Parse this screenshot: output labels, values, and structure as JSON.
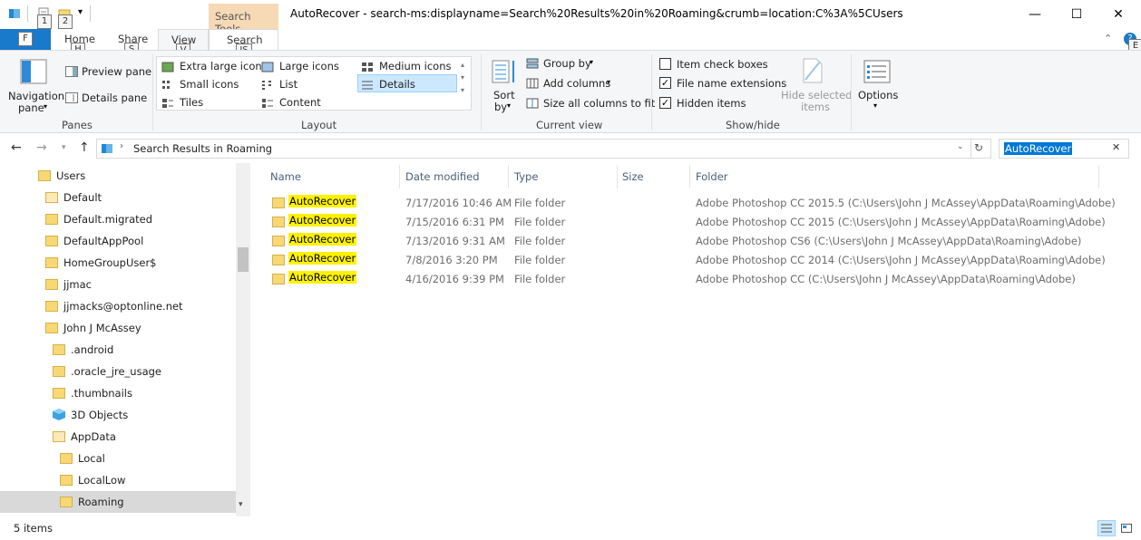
{
  "window": {
    "title": "AutoRecover - search-ms:displayname=Search%20Results%20in%20Roaming&crumb=location:C%3A%5CUsers",
    "context_tab": "Search Tools",
    "minimize": "—",
    "maximize": "☐",
    "close": "✕"
  },
  "qat": {
    "keytip_1": "1",
    "keytip_2": "2"
  },
  "tabs": {
    "file": "F",
    "home": "Home",
    "home_keytip": "H",
    "share": "Share",
    "share_keytip": "S",
    "view": "View",
    "view_keytip": "V",
    "search": "Search",
    "search_keytip": "JS",
    "help_keytip": "E"
  },
  "ribbon": {
    "panes": {
      "navigation_pane": "Navigation",
      "navigation_pane_2": "pane",
      "preview_pane": "Preview pane",
      "details_pane": "Details pane",
      "label": "Panes"
    },
    "layout": {
      "extra_large": "Extra large icons",
      "large": "Large icons",
      "medium": "Medium icons",
      "small": "Small icons",
      "list": "List",
      "details": "Details",
      "tiles": "Tiles",
      "content": "Content",
      "label": "Layout"
    },
    "current_view": {
      "sort_by": "Sort",
      "sort_by_2": "by",
      "group_by": "Group by",
      "add_columns": "Add columns",
      "size_all": "Size all columns to fit",
      "label": "Current view"
    },
    "show_hide": {
      "item_check_boxes": "Item check boxes",
      "item_check_boxes_checked": false,
      "file_name_extensions": "File name extensions",
      "file_name_extensions_checked": true,
      "hidden_items": "Hidden items",
      "hidden_items_checked": true,
      "hide_selected": "Hide selected",
      "hide_selected_2": "items",
      "label": "Show/hide"
    },
    "options": {
      "label": "Options"
    }
  },
  "address": {
    "breadcrumb": "Search Results in Roaming",
    "search_value": "AutoRecover"
  },
  "nav_tree": [
    {
      "label": "Users",
      "indent": 1
    },
    {
      "label": "Default",
      "indent": 2,
      "pale": true
    },
    {
      "label": "Default.migrated",
      "indent": 2
    },
    {
      "label": "DefaultAppPool",
      "indent": 2
    },
    {
      "label": "HomeGroupUser$",
      "indent": 2
    },
    {
      "label": "jjmac",
      "indent": 2
    },
    {
      "label": "jjmacks@optonline.net",
      "indent": 2
    },
    {
      "label": "John J McAssey",
      "indent": 2
    },
    {
      "label": ".android",
      "indent": 3
    },
    {
      "label": ".oracle_jre_usage",
      "indent": 3
    },
    {
      "label": ".thumbnails",
      "indent": 3
    },
    {
      "label": "3D Objects",
      "indent": 3,
      "icon": "3d"
    },
    {
      "label": "AppData",
      "indent": 3,
      "pale": true
    },
    {
      "label": "Local",
      "indent": 4
    },
    {
      "label": "LocalLow",
      "indent": 4
    },
    {
      "label": "Roaming",
      "indent": 4,
      "selected": true
    }
  ],
  "columns": {
    "name": "Name",
    "date": "Date modified",
    "type": "Type",
    "size": "Size",
    "folder": "Folder"
  },
  "files": [
    {
      "name": "AutoRecover",
      "date": "7/17/2016 10:46 AM",
      "type": "File folder",
      "size": "",
      "folder": "Adobe Photoshop CC 2015.5 (C:\\Users\\John J McAssey\\AppData\\Roaming\\Adobe)"
    },
    {
      "name": "AutoRecover",
      "date": "7/15/2016 6:31 PM",
      "type": "File folder",
      "size": "",
      "folder": "Adobe Photoshop CC 2015 (C:\\Users\\John J McAssey\\AppData\\Roaming\\Adobe)"
    },
    {
      "name": "AutoRecover",
      "date": "7/13/2016 9:31 AM",
      "type": "File folder",
      "size": "",
      "folder": "Adobe Photoshop CS6 (C:\\Users\\John J McAssey\\AppData\\Roaming\\Adobe)"
    },
    {
      "name": "AutoRecover",
      "date": "7/8/2016 3:20 PM",
      "type": "File folder",
      "size": "",
      "folder": "Adobe Photoshop CC 2014 (C:\\Users\\John J McAssey\\AppData\\Roaming\\Adobe)"
    },
    {
      "name": "AutoRecover",
      "date": "4/16/2016 9:39 PM",
      "type": "File folder",
      "size": "",
      "folder": "Adobe Photoshop CC (C:\\Users\\John J McAssey\\AppData\\Roaming\\Adobe)"
    }
  ],
  "status": {
    "count": "5 items"
  },
  "colors": {
    "file_tab": "#1979ca",
    "highlight": "#fff200",
    "selection": "#cce8ff",
    "folder": "#f8d775"
  }
}
